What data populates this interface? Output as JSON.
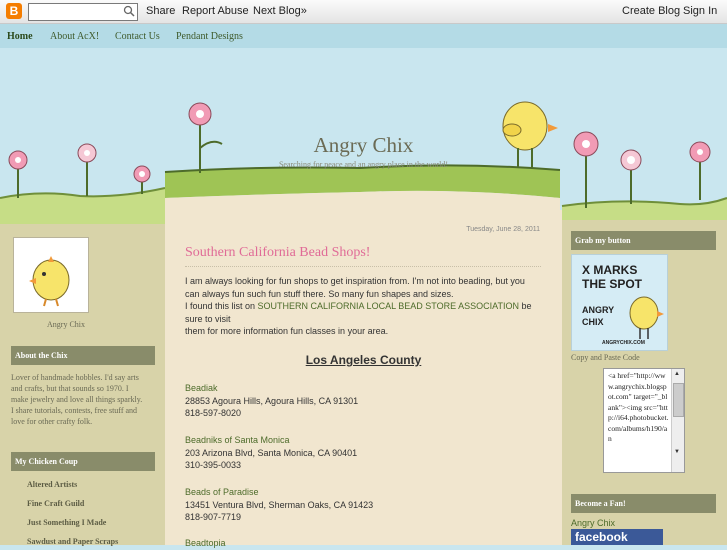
{
  "navbar": {
    "logo_glyph": "B",
    "search_placeholder": "",
    "share": "Share",
    "report": "Report Abuse",
    "next": "Next Blog»",
    "create": "Create Blog",
    "signin": "Sign In"
  },
  "tabs": [
    "Home",
    "About AcX!",
    "Contact Us",
    "Pendant Designs"
  ],
  "header": {
    "title": "Angry Chix",
    "description": "Searching for peace and an angry place in the world!"
  },
  "left": {
    "profile_caption": "Angry Chix",
    "about_heading": "About the Chix",
    "about_lines": [
      "Lover of handmade hobbles. I'd say arts",
      "and crafts, but that sounds so 1970. I",
      "make jewelry and love all things sparkly.",
      "I share tutorials, contests, free stuff and",
      "love for other crafty folk."
    ],
    "coop_heading": "My Chicken Coup",
    "coop_links": [
      "Altered Artists",
      "Fine Craft Guild",
      "Just Something I Made",
      "Sawdust and Paper Scraps"
    ]
  },
  "post": {
    "date": "Tuesday, June 28, 2011",
    "title": "Southern California Bead Shops!",
    "p1": "I am always looking for fun shops to get inspiration from.   I'm not into beading, but you",
    "p2": "can always fun such fun stuff there.  So many fun shapes and sizes.",
    "p3a": "I found this list on ",
    "p3link": "SOUTHERN CALIFORNIA LOCAL BEAD STORE ASSOCIATION",
    "p3b": " be",
    "p4": "sure to visit",
    "p5": "them for more information fun classes in your area.",
    "county": "Los Angeles County",
    "shops": [
      {
        "name": "Beadiak",
        "address": "28853 Agoura Hills, Agoura Hills, CA 91301",
        "phone": "818-597-8020"
      },
      {
        "name": "Beadniks of Santa Monica",
        "address": "203 Arizona Blvd, Santa Monica, CA 90401",
        "phone": "310-395-0033"
      },
      {
        "name": "Beads of Paradise",
        "address": "13451 Ventura Blvd, Sherman Oaks, CA 91423",
        "phone": "818-907-7719"
      },
      {
        "name": "Beadtopia",
        "address": "",
        "phone": ""
      }
    ]
  },
  "right": {
    "grab_heading": "Grab my button",
    "button_line1": "X MARKS",
    "button_line2": "THE SPOT",
    "button_line3": "ANGRY",
    "button_line4": "CHIX",
    "button_url": "ANGRYCHIX.COM",
    "copy_label": "Copy and Paste Code",
    "code": "<a href=\"http://www.angrychix.blogspot.com\" target=\"_blank\"><img src=\"http://i64.photobucket.com/albums/h190/an",
    "fan_heading": "Become a Fan!",
    "fan_name": "Angry Chix",
    "facebook": "facebook"
  },
  "colors": {
    "sky": "#c9e6ef",
    "sidebar": "#d8d3a9",
    "main": "#f1e6cf",
    "heading_bar": "#898c6a",
    "title_pink": "#e06b97",
    "link_green": "#4d6b2a"
  }
}
